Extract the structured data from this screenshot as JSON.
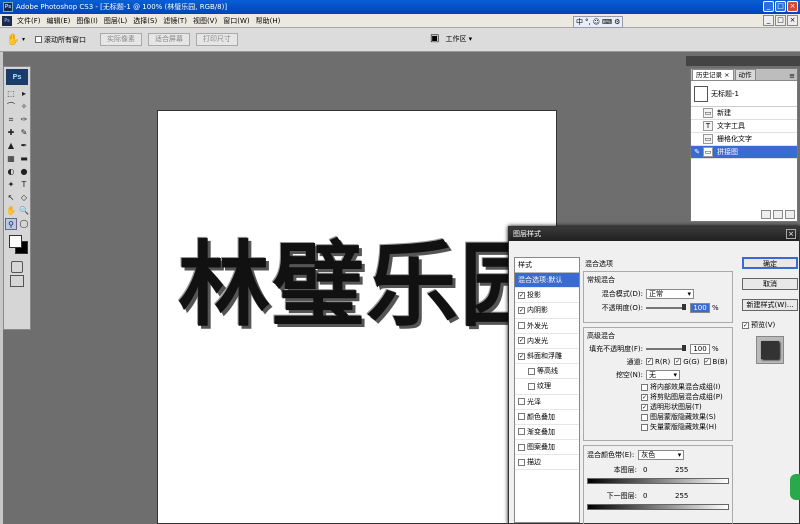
{
  "window": {
    "app_icon": "Ps",
    "title": "Adobe Photoshop CS3 - [无标题-1 @ 100% (林璧乐园, RGB/8)]",
    "buttons": [
      "_",
      "□",
      "×"
    ]
  },
  "menu": {
    "items": [
      "文件(F)",
      "编辑(E)",
      "图像(I)",
      "图层(L)",
      "选择(S)",
      "滤镜(T)",
      "视图(V)",
      "窗口(W)",
      "帮助(H)"
    ],
    "ime": [
      "中",
      "°,",
      "☺",
      "⌨",
      "⚙"
    ]
  },
  "options": {
    "scroll_all_label": "滚动所有窗口",
    "actual_pixels": "实际像素",
    "fit_screen": "适合屏幕",
    "print_size": "打印尺寸",
    "workspace": "工作区 ▾"
  },
  "toolbox": {
    "header": "Ps",
    "tools": [
      "⬚",
      "▸",
      "⌒",
      "✧",
      "⌗",
      "✑",
      "✚",
      "✎",
      "▲",
      "✒",
      "▦",
      "▬",
      "◐",
      "●",
      "✦",
      "T",
      "↖",
      "◇",
      "✋",
      "🔍",
      "⚲",
      "◯"
    ]
  },
  "canvas": {
    "text": "林璧乐园"
  },
  "history": {
    "tabs": [
      "历史记录 ×",
      "动作"
    ],
    "menu_icon": "≡",
    "snapshot": "无标题-1",
    "states": [
      {
        "label": "新建",
        "icon": "▭"
      },
      {
        "label": "文字工具",
        "icon": "T"
      },
      {
        "label": "栅格化文字",
        "icon": "▭"
      },
      {
        "label": "拼接图",
        "icon": "▭"
      }
    ]
  },
  "dialog": {
    "title": "图层样式",
    "close": "×",
    "styles_header": "样式",
    "styles": [
      {
        "label": "混合选项:默认",
        "check": false,
        "selected": true,
        "sub": false
      },
      {
        "label": "投影",
        "check": true,
        "selected": false,
        "sub": false
      },
      {
        "label": "内阴影",
        "check": true,
        "selected": false,
        "sub": false
      },
      {
        "label": "外发光",
        "check": false,
        "selected": false,
        "sub": false
      },
      {
        "label": "内发光",
        "check": true,
        "selected": false,
        "sub": false
      },
      {
        "label": "斜面和浮雕",
        "check": true,
        "selected": false,
        "sub": false
      },
      {
        "label": "等高线",
        "check": false,
        "selected": false,
        "sub": true
      },
      {
        "label": "纹理",
        "check": false,
        "selected": false,
        "sub": true
      },
      {
        "label": "光泽",
        "check": false,
        "selected": false,
        "sub": false
      },
      {
        "label": "颜色叠加",
        "check": false,
        "selected": false,
        "sub": false
      },
      {
        "label": "渐变叠加",
        "check": false,
        "selected": false,
        "sub": false
      },
      {
        "label": "图案叠加",
        "check": false,
        "selected": false,
        "sub": false
      },
      {
        "label": "描边",
        "check": false,
        "selected": false,
        "sub": false
      }
    ],
    "blend": {
      "section": "混合选项",
      "general": "常规混合",
      "mode_label": "混合模式(D):",
      "mode_value": "正常",
      "opacity_label": "不透明度(O):",
      "opacity_value": "100",
      "opacity_fraction": 1.0,
      "pct": "%",
      "advanced": "高级混合",
      "fill_label": "填充不透明度(F):",
      "fill_value": "100",
      "fill_fraction": 1.0,
      "channels_label": "通道:",
      "channels": [
        "R(R)",
        "G(G)",
        "B(B)"
      ],
      "knockout_label": "挖空(N):",
      "knockout_value": "无",
      "options": [
        {
          "label": "将内部效果混合成组(I)",
          "check": false
        },
        {
          "label": "将剪贴图层混合成组(P)",
          "check": true
        },
        {
          "label": "透明形状图层(T)",
          "check": true
        },
        {
          "label": "图层蒙版隐藏效果(S)",
          "check": false
        },
        {
          "label": "矢量蒙版隐藏效果(H)",
          "check": false
        }
      ],
      "blend_if_label": "混合颜色带(E):",
      "blend_if_value": "灰色",
      "this_layer": "本图层:",
      "underlying": "下一图层:",
      "min": "0",
      "max": "255"
    },
    "buttons": {
      "ok": "确定",
      "cancel": "取消",
      "new_style": "新建样式(W)...",
      "preview": "预览(V)"
    }
  }
}
